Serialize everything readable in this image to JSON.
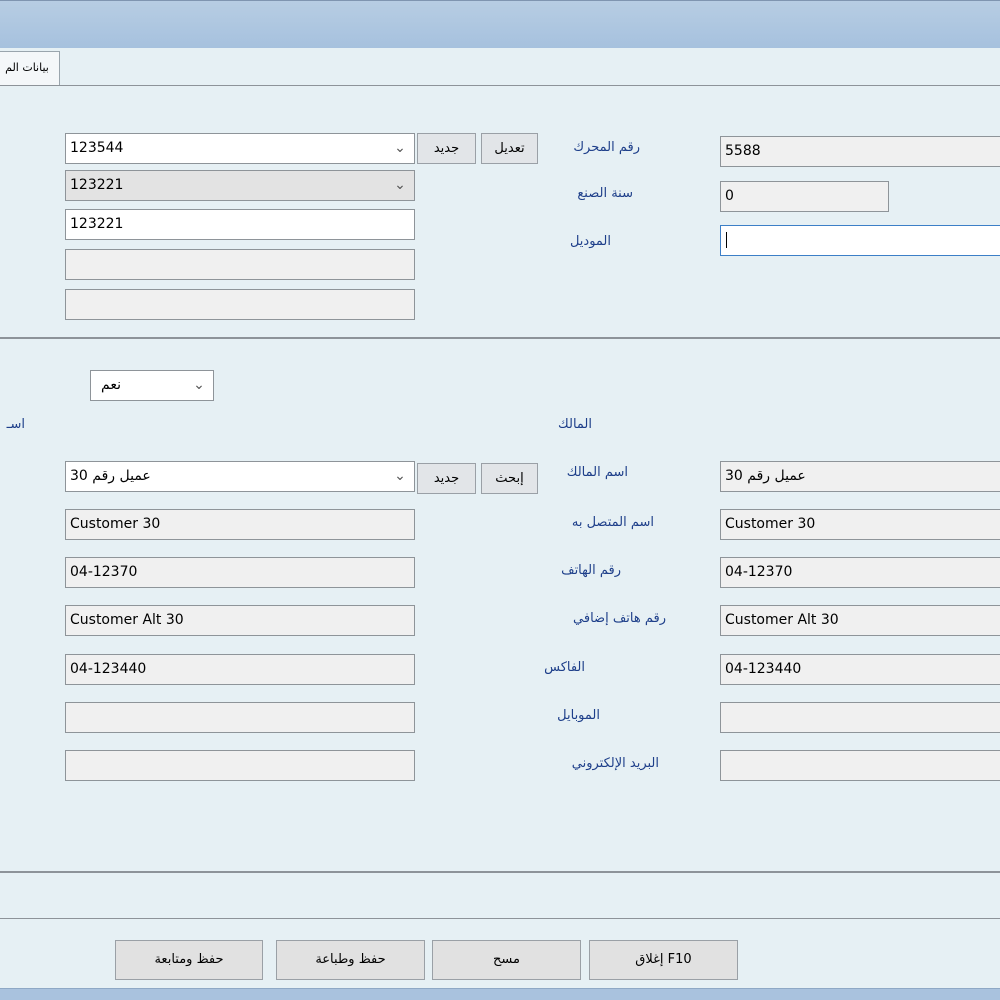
{
  "tab": {
    "label": "بيانات الم"
  },
  "vehicle": {
    "engine_number_label": "رقم المحرك",
    "year_label": "سنة الصنع",
    "model_label": "الموديل",
    "engine_number_value": "5588",
    "year_value": "0",
    "model_value": "",
    "combo1_value": "123544",
    "combo2_value": "123221",
    "field3_value": "123221",
    "field4_value": "",
    "field5_value": "",
    "new_button": "جديد",
    "edit_button": "تعديل"
  },
  "owner": {
    "yes_select_value": "نعم",
    "partial_label": "اسـ",
    "owner_heading": "المالك",
    "owner_name_label": "اسم المالك",
    "contact_name_label": "اسم المتصل به",
    "phone_label": "رقم الهاتف",
    "extra_phone_label": "رقم هاتف إضافي",
    "fax_label": "الفاكس",
    "mobile_label": "الموبايل",
    "email_label": "البريد الإلكتروني",
    "search_button": "إبحث",
    "new_button": "جديد",
    "left": {
      "owner_combo": "عميل رقم 30",
      "contact": "Customer 30",
      "phone": "04-12370",
      "extra_phone": "Customer Alt 30",
      "fax": "04-123440",
      "mobile": "",
      "email": ""
    },
    "right": {
      "owner_name": "عميل رقم 30",
      "contact": "Customer 30",
      "phone": "04-12370",
      "extra_phone": "Customer Alt 30",
      "fax": "04-123440",
      "mobile": "",
      "email": ""
    }
  },
  "footer": {
    "save_continue": "حفظ ومتابعة",
    "save_print": "حفظ وطباعة",
    "clear": "مسح",
    "close": "F10 إغلاق"
  },
  "icons": {
    "dropdown": "chevron-down-icon"
  },
  "colors": {
    "background": "#e6f0f4",
    "label": "#1e3f8a",
    "titlebar": "#a6c1de"
  }
}
